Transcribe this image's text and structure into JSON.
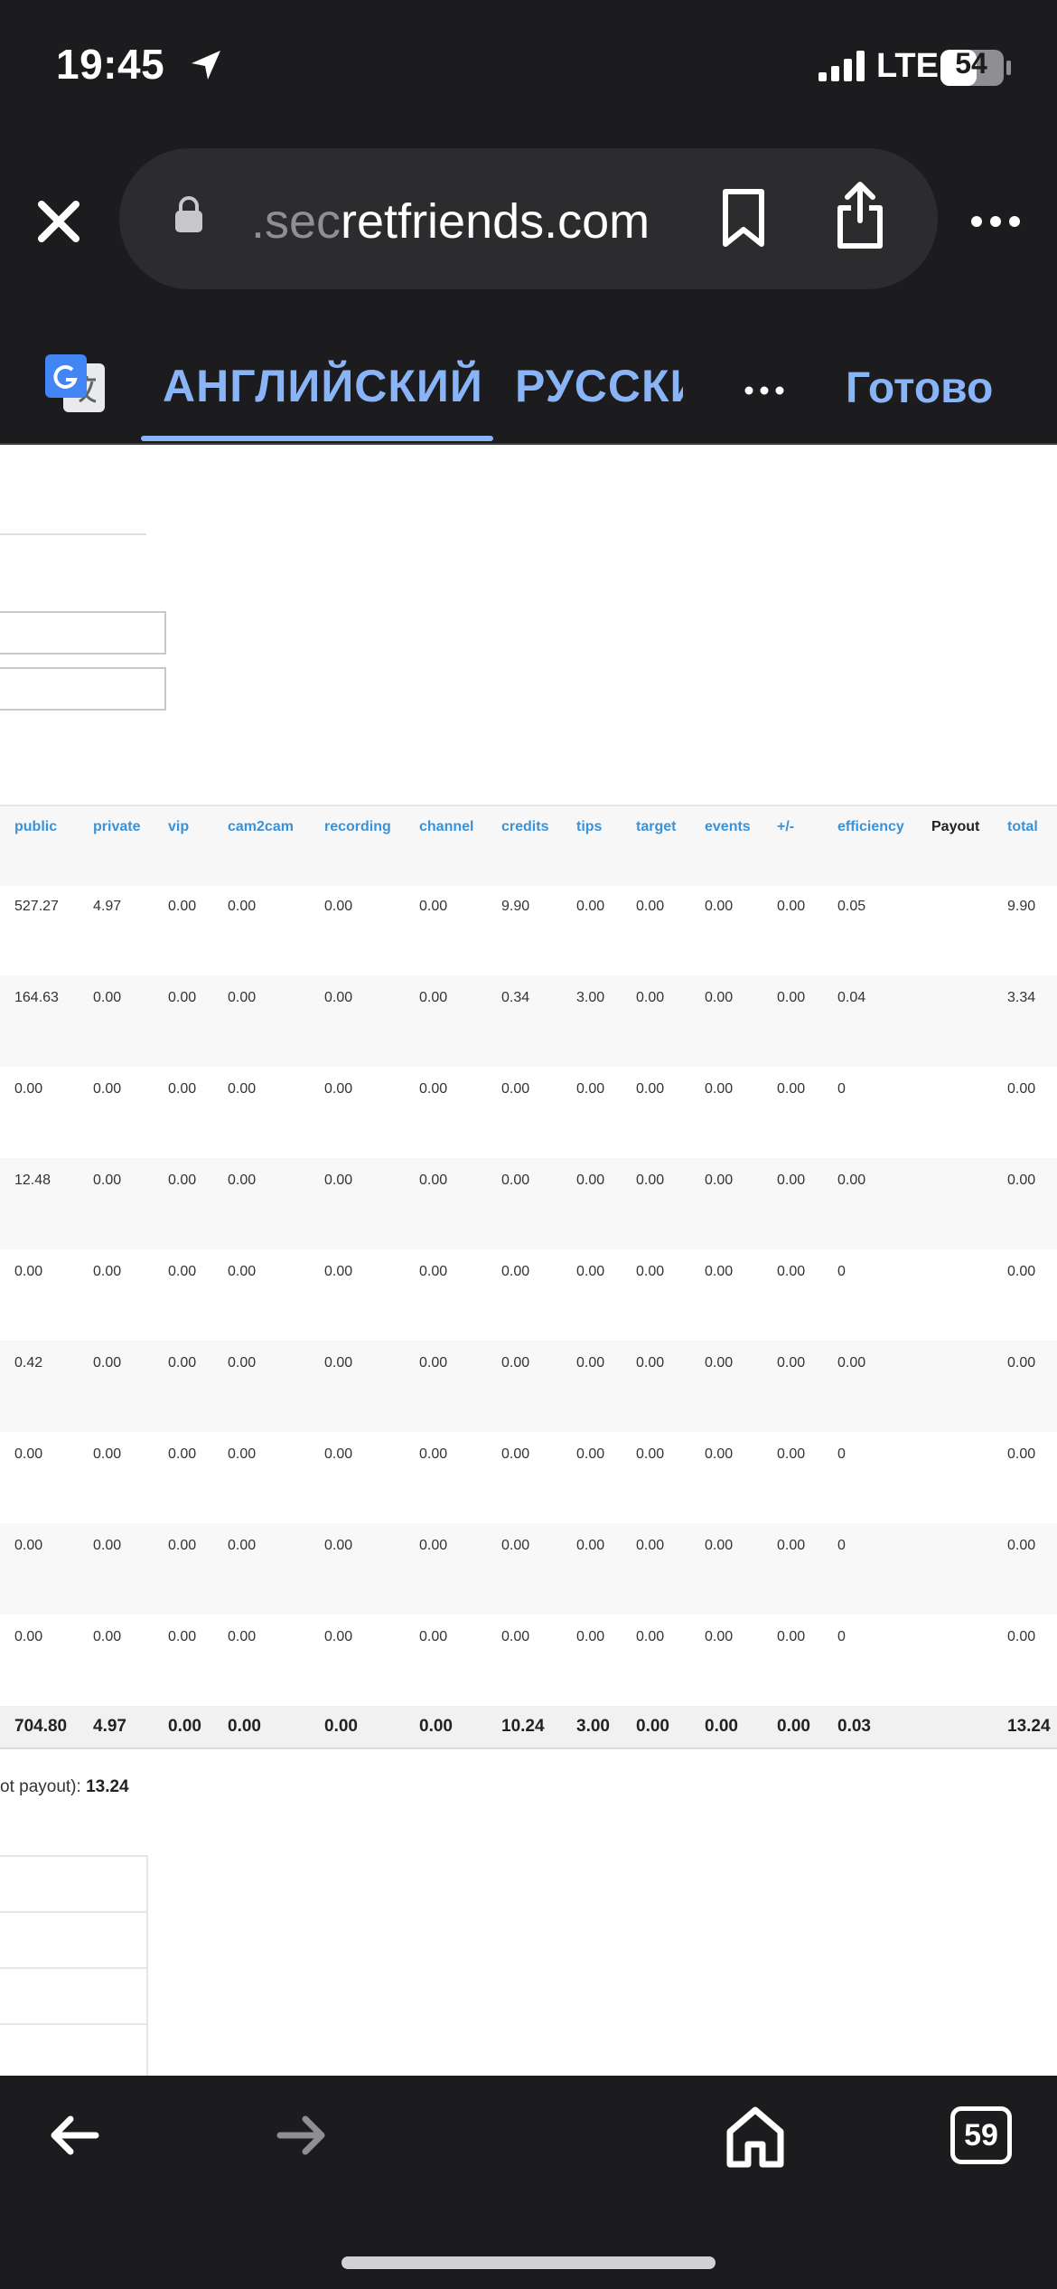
{
  "status": {
    "time": "19:45",
    "network": "LTE",
    "battery": "54"
  },
  "browser": {
    "url_prefix": ".sec",
    "url_main": "retfriends.com"
  },
  "translate": {
    "lang_source": "АНГЛИЙСКИЙ",
    "lang_target": "РУССКИЙ",
    "done_label": "Готово"
  },
  "table": {
    "headers": [
      "public",
      "private",
      "vip",
      "cam2cam",
      "recording",
      "channel",
      "credits",
      "tips",
      "target",
      "events",
      "+/-",
      "efficiency",
      "Payout",
      "total"
    ],
    "rows": [
      [
        "527.27",
        "4.97",
        "0.00",
        "0.00",
        "0.00",
        "0.00",
        "9.90",
        "0.00",
        "0.00",
        "0.00",
        "0.00",
        "0.05",
        "",
        "9.90"
      ],
      [
        "164.63",
        "0.00",
        "0.00",
        "0.00",
        "0.00",
        "0.00",
        "0.34",
        "3.00",
        "0.00",
        "0.00",
        "0.00",
        "0.04",
        "",
        "3.34"
      ],
      [
        "0.00",
        "0.00",
        "0.00",
        "0.00",
        "0.00",
        "0.00",
        "0.00",
        "0.00",
        "0.00",
        "0.00",
        "0.00",
        "0",
        "",
        "0.00"
      ],
      [
        "12.48",
        "0.00",
        "0.00",
        "0.00",
        "0.00",
        "0.00",
        "0.00",
        "0.00",
        "0.00",
        "0.00",
        "0.00",
        "0.00",
        "",
        "0.00"
      ],
      [
        "0.00",
        "0.00",
        "0.00",
        "0.00",
        "0.00",
        "0.00",
        "0.00",
        "0.00",
        "0.00",
        "0.00",
        "0.00",
        "0",
        "",
        "0.00"
      ],
      [
        "0.42",
        "0.00",
        "0.00",
        "0.00",
        "0.00",
        "0.00",
        "0.00",
        "0.00",
        "0.00",
        "0.00",
        "0.00",
        "0.00",
        "",
        "0.00"
      ],
      [
        "0.00",
        "0.00",
        "0.00",
        "0.00",
        "0.00",
        "0.00",
        "0.00",
        "0.00",
        "0.00",
        "0.00",
        "0.00",
        "0",
        "",
        "0.00"
      ],
      [
        "0.00",
        "0.00",
        "0.00",
        "0.00",
        "0.00",
        "0.00",
        "0.00",
        "0.00",
        "0.00",
        "0.00",
        "0.00",
        "0",
        "",
        "0.00"
      ],
      [
        "0.00",
        "0.00",
        "0.00",
        "0.00",
        "0.00",
        "0.00",
        "0.00",
        "0.00",
        "0.00",
        "0.00",
        "0.00",
        "0",
        "",
        "0.00"
      ]
    ],
    "totals": [
      "704.80",
      "4.97",
      "0.00",
      "0.00",
      "0.00",
      "0.00",
      "10.24",
      "3.00",
      "0.00",
      "0.00",
      "0.00",
      "0.03",
      "",
      "13.24"
    ]
  },
  "payout_note": {
    "label": "ot payout):",
    "value": "13.24"
  },
  "toolbar": {
    "tab_count": "59"
  }
}
